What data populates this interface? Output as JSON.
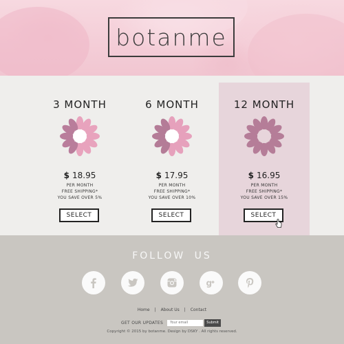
{
  "brand": {
    "logo_text": "botanme"
  },
  "plans": [
    {
      "title": "3 MONTH",
      "currency": "$",
      "price": "18.95",
      "per": "PER MONTH",
      "shipping": "FREE SHIPPING*",
      "save": "YOU SAVE OVER 5%",
      "button": "SELECT",
      "highlight": false,
      "flower_color_a": "#e8a3bd",
      "flower_color_b": "#b97d9b"
    },
    {
      "title": "6 MONTH",
      "currency": "$",
      "price": "17.95",
      "per": "PER MONTH",
      "shipping": "FREE SHIPPING*",
      "save": "YOU SAVE OVER 10%",
      "button": "SELECT",
      "highlight": false,
      "flower_color_a": "#e6a1bc",
      "flower_color_b": "#b47c97"
    },
    {
      "title": "12 MONTH",
      "currency": "$",
      "price": "16.95",
      "per": "PER MONTH",
      "shipping": "FREE SHIPPING*",
      "save": "YOU SAVE OVER 15%",
      "button": "SELECT",
      "highlight": true,
      "flower_color_a": "#b57d98",
      "flower_color_b": "#b57d98"
    }
  ],
  "footer": {
    "follow_label": "FOLLOW US",
    "social": [
      {
        "name": "facebook-icon"
      },
      {
        "name": "twitter-icon"
      },
      {
        "name": "instagram-icon"
      },
      {
        "name": "google-plus-icon"
      },
      {
        "name": "pinterest-icon"
      }
    ],
    "links": [
      "Home",
      "About Us",
      "Contact"
    ],
    "newsletter_label": "GET OUR UPDATES",
    "email_placeholder": "Your email",
    "submit_label": "Submit",
    "copyright": "Copyright © 2015 by botanme. Design by DSKY . All rights reserved."
  },
  "colors": {
    "highlight_bg": "#e7d5db",
    "footer_bg": "#c9c6c1",
    "body_bg": "#efeeec",
    "icon_gray": "#c9c6c1"
  }
}
